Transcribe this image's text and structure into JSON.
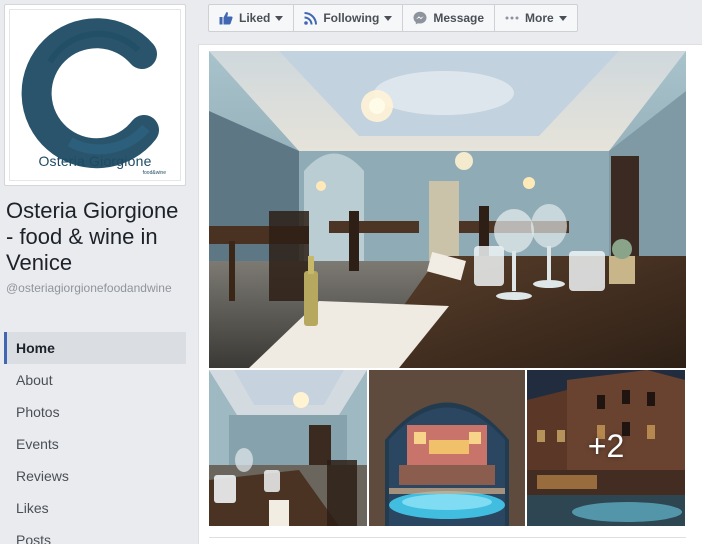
{
  "profile": {
    "logo_name": "Osteria Giorgione",
    "logo_sub": "food&wine",
    "page_name": "Osteria Giorgione - food & wine in Venice",
    "handle": "@osteriagiorgionefoodandwine"
  },
  "nav": {
    "items": [
      {
        "label": "Home",
        "active": true
      },
      {
        "label": "About"
      },
      {
        "label": "Photos"
      },
      {
        "label": "Events"
      },
      {
        "label": "Reviews"
      },
      {
        "label": "Likes"
      },
      {
        "label": "Posts"
      }
    ]
  },
  "actions": {
    "liked": "Liked",
    "following": "Following",
    "message": "Message",
    "more": "More"
  },
  "photos": {
    "more_count": "+2"
  },
  "colors": {
    "brand_blue": "#4267b2",
    "logo_navy": "#1e4b63"
  }
}
